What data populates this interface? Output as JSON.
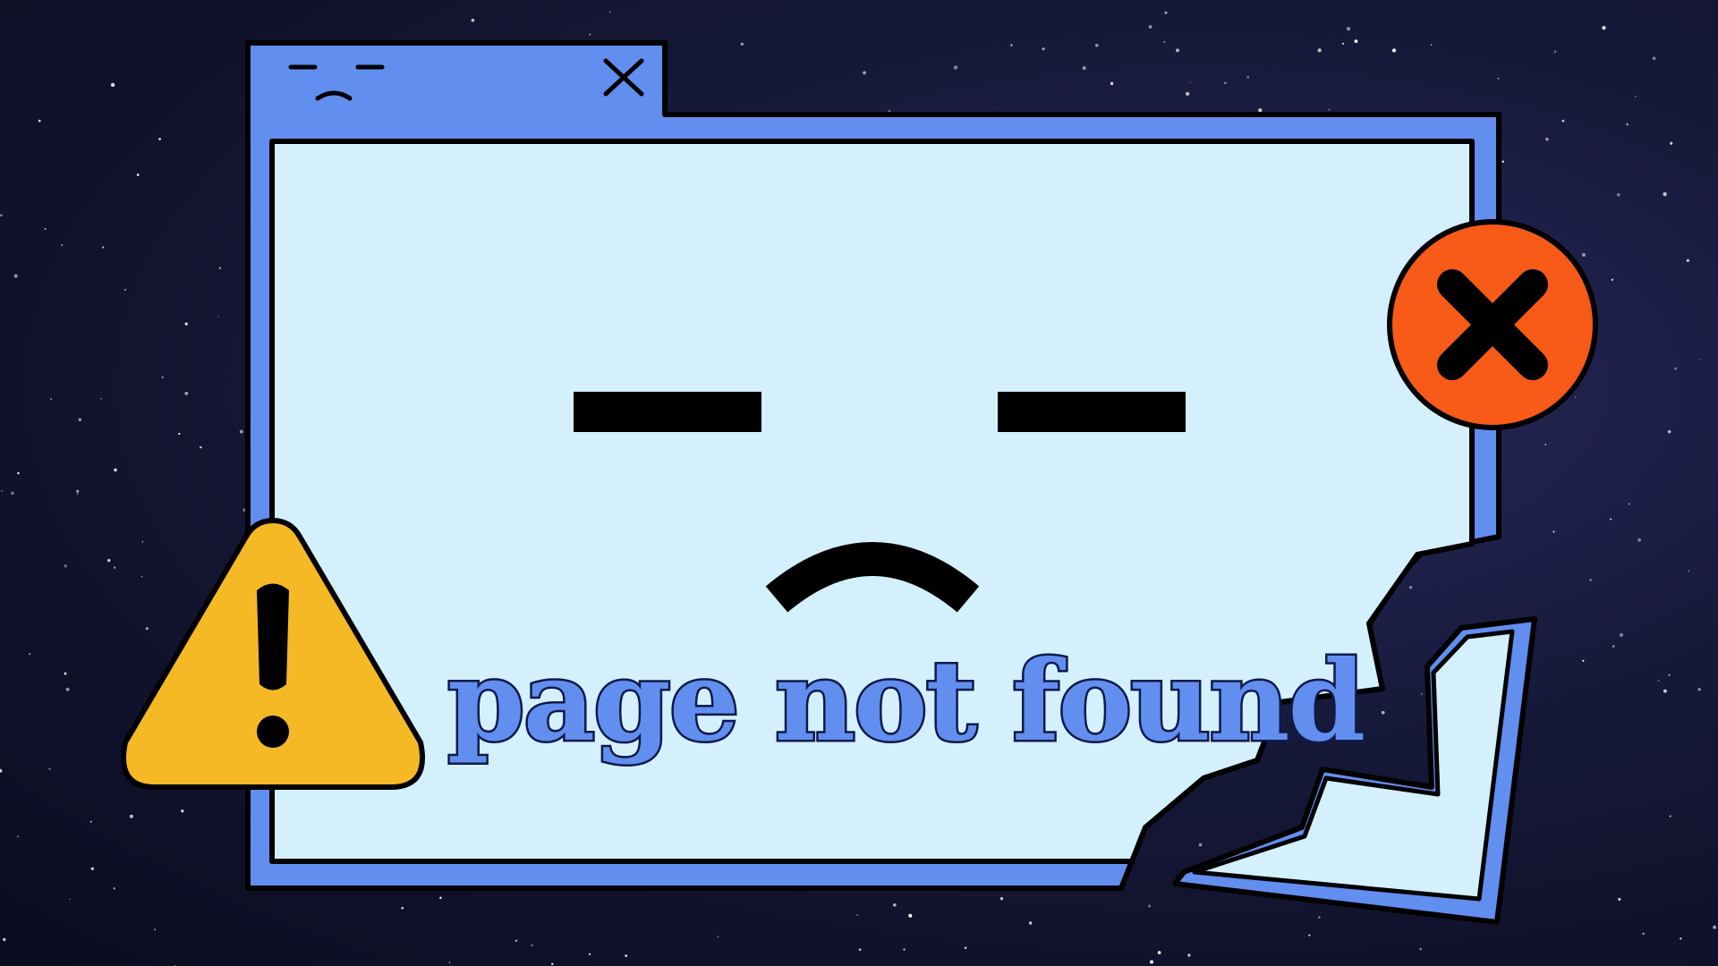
{
  "message": "page not found",
  "colors": {
    "window_frame": "#628ef0",
    "window_content": "#d4f0fd",
    "outline": "#000000",
    "caption_fill": "#628ef0",
    "caption_outline": "#0e1a4a",
    "error_badge": "#f85a17",
    "warning_badge": "#f6b926",
    "space_background": "#161838",
    "stars": "#ffffff"
  },
  "icons": {
    "title_bar_face": "sad-face-icon",
    "title_bar_close": "close-icon",
    "error_badge": "error-x-icon",
    "warning_badge": "warning-triangle-icon",
    "main_face": "sad-face-icon"
  }
}
